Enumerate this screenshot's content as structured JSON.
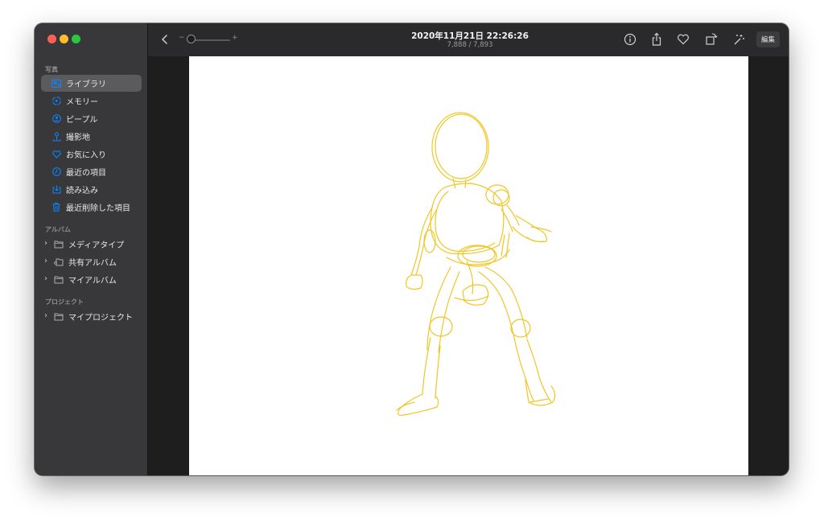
{
  "colors": {
    "accent": "#0a84ff",
    "sketch": "#f0c419",
    "sidebar": "#38383a",
    "toolbar": "#2a2a2c"
  },
  "sidebar": {
    "photos_header": "写真",
    "items": [
      {
        "label": "ライブラリ",
        "icon": "photo-library-icon",
        "selected": true
      },
      {
        "label": "メモリー",
        "icon": "memories-icon"
      },
      {
        "label": "ピープル",
        "icon": "people-icon"
      },
      {
        "label": "撮影地",
        "icon": "places-icon"
      },
      {
        "label": "お気に入り",
        "icon": "heart-icon"
      },
      {
        "label": "最近の項目",
        "icon": "clock-icon"
      },
      {
        "label": "読み込み",
        "icon": "import-icon"
      },
      {
        "label": "最近削除した項目",
        "icon": "trash-icon"
      }
    ],
    "albums_header": "アルバム",
    "albums": [
      {
        "label": "メディアタイプ",
        "icon": "folder-icon"
      },
      {
        "label": "共有アルバム",
        "icon": "shared-folder-icon"
      },
      {
        "label": "マイアルバム",
        "icon": "folder-icon"
      }
    ],
    "projects_header": "プロジェクト",
    "projects": [
      {
        "label": "マイプロジェクト",
        "icon": "folder-icon"
      }
    ]
  },
  "toolbar": {
    "title": "2020年11月21日 22:26:26",
    "subtitle": "7,888 / 7,893",
    "zoom_minus": "−",
    "zoom_plus": "+",
    "edit_label": "編集",
    "icons": [
      "info-icon",
      "share-icon",
      "favorite-heart-icon",
      "rotate-icon",
      "auto-enhance-icon"
    ]
  }
}
